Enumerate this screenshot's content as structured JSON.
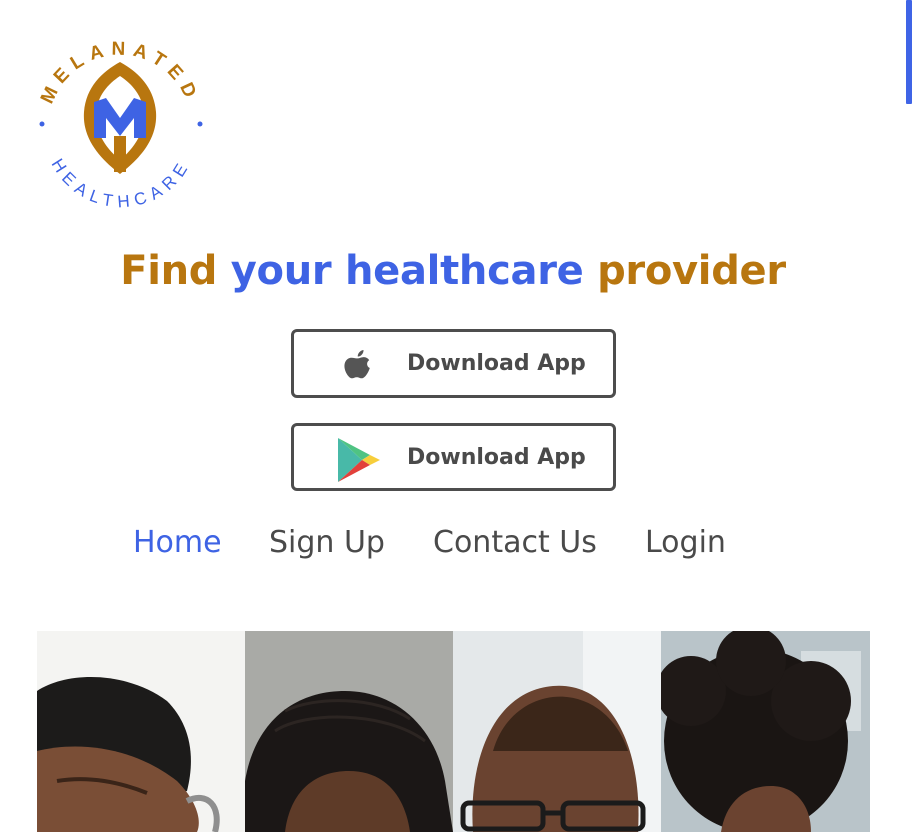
{
  "brand": {
    "arc_text_top": "MELANATED",
    "arc_text_bottom": "HEALTHCARE",
    "colors": {
      "gold": "#b8760f",
      "blue": "#3e63e4"
    }
  },
  "hero": {
    "headline_word1": "Find",
    "headline_word2": "your",
    "headline_word3": "healthcare",
    "headline_word4": "provider"
  },
  "downloads": [
    {
      "icon": "apple-icon",
      "label": "Download App"
    },
    {
      "icon": "google-play-icon",
      "label": "Download App"
    }
  ],
  "nav": {
    "items": [
      {
        "label": "Home",
        "active": true
      },
      {
        "label": "Sign Up",
        "active": false
      },
      {
        "label": "Contact Us",
        "active": false
      },
      {
        "label": "Login",
        "active": false
      }
    ]
  },
  "gallery": {
    "photos": [
      {
        "subject": "doctor-with-stethoscope-photo"
      },
      {
        "subject": "woman-with-braids-photo"
      },
      {
        "subject": "man-with-glasses-photo"
      },
      {
        "subject": "woman-with-curly-hair-photo"
      }
    ]
  }
}
